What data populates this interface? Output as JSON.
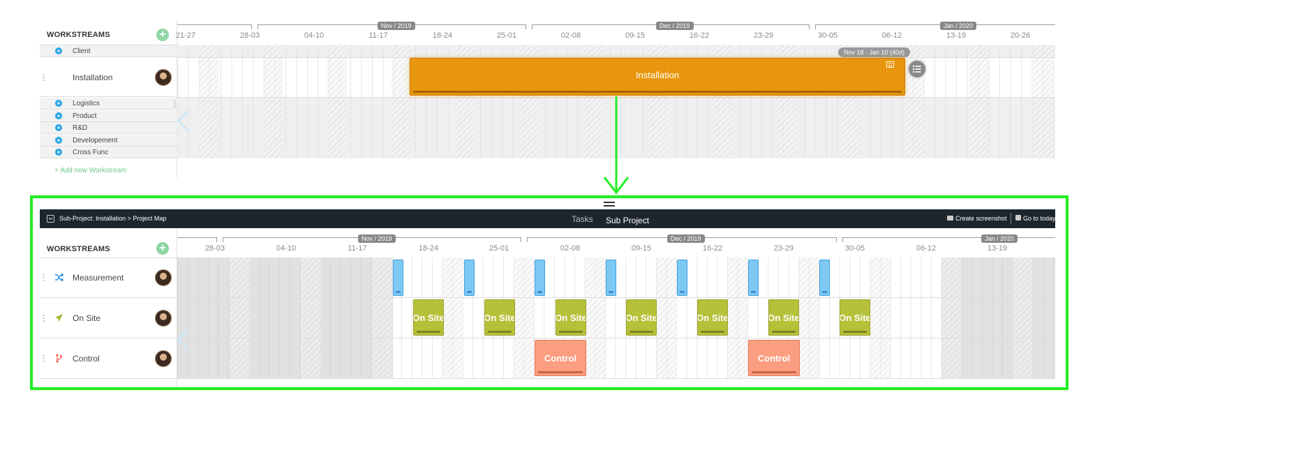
{
  "top": {
    "workstreams_header": "WORKSTREAMS",
    "add_icon": "plus-circle-icon",
    "add_new_label": "+ Add new Workstream",
    "rows": [
      {
        "label": "Client"
      },
      {
        "label": "Installation"
      },
      {
        "label": "Logistics"
      },
      {
        "label": "Product"
      },
      {
        "label": "R&D"
      },
      {
        "label": "Developement"
      },
      {
        "label": "Cross Func"
      }
    ],
    "weeks": [
      "21-27",
      "28-03",
      "04-10",
      "11-17",
      "18-24",
      "25-01",
      "02-08",
      "09-15",
      "16-22",
      "23-29",
      "30-05",
      "06-12",
      "13-19",
      "20-26"
    ],
    "months": [
      "Nov / 2019",
      "Dec / 2019",
      "Jan / 2020"
    ],
    "installation_bar": {
      "label": "Installation",
      "range_label": "Nov 18 - Jan 10 (40d)",
      "color": "#e8960e"
    }
  },
  "bottom": {
    "breadcrumb": "Sub-Project: Installation > Project Map",
    "tabs": [
      {
        "label": "Tasks"
      },
      {
        "label": "Sub Project"
      }
    ],
    "actions": {
      "screenshot": "Create screenshot",
      "today": "Go to today"
    },
    "workstreams_header": "WORKSTREAMS",
    "rows": [
      {
        "label": "Measurement",
        "icon": "shuffle-icon"
      },
      {
        "label": "On Site",
        "icon": "paper-plane-icon"
      },
      {
        "label": "Control",
        "icon": "git-branch-icon"
      }
    ],
    "weeks": [
      "28-03",
      "04-10",
      "11-17",
      "18-24",
      "25-01",
      "02-08",
      "09-15",
      "16-22",
      "23-29",
      "30-05",
      "06-12",
      "13-19"
    ],
    "months": [
      "Nov / 2019",
      "Dec / 2019",
      "Jan / 2020"
    ],
    "onsite_label": "On Site",
    "control_label": "Control"
  },
  "colors": {
    "highlight": "#22ee22",
    "header_bg": "#1d262d",
    "onsite": "#b6c13a",
    "control": "#fb9d7f",
    "measure": "#7dc9f4"
  }
}
